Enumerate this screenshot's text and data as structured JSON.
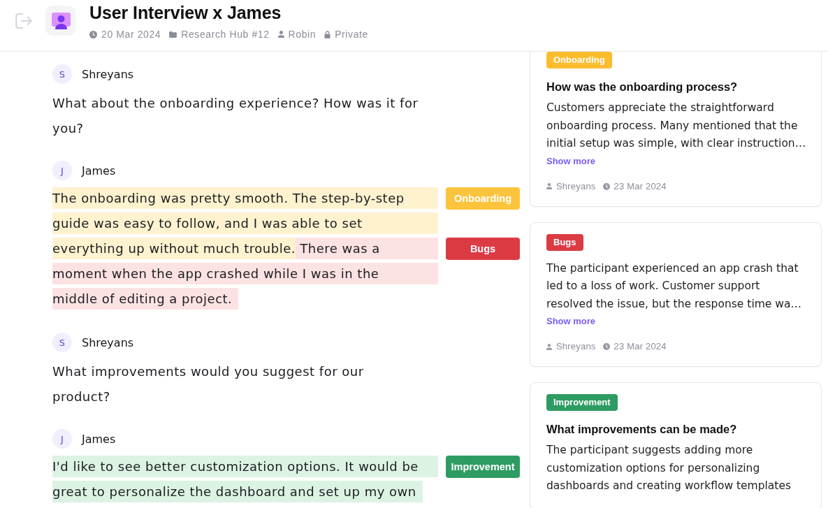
{
  "header": {
    "title": "User Interview x James",
    "meta": [
      {
        "kind": "date",
        "text": "20 Mar 2024"
      },
      {
        "kind": "folder",
        "text": "Research Hub #12"
      },
      {
        "kind": "owner",
        "text": "Robin"
      },
      {
        "kind": "visibility",
        "text": "Private"
      }
    ]
  },
  "transcript": [
    {
      "kind": "plain",
      "speaker": "Shreyans",
      "initial": "S",
      "text": "What about the onboarding experience? How was it for you?"
    },
    {
      "kind": "highlighted",
      "speaker": "James",
      "initial": "J",
      "lines": [
        [
          {
            "text": "The onboarding was pretty smooth. The step-by-step",
            "color": "#fef2cf"
          }
        ],
        [
          {
            "text": "guide was easy to follow, and I was able to set",
            "color": "#fef2cf"
          }
        ],
        [
          {
            "text": "everything up without much trouble.",
            "color": "#fef2cf"
          },
          {
            "text": " There was a",
            "color": "#fde2e3"
          }
        ],
        [
          {
            "text": "moment when the app crashed while I was in the",
            "color": "#fde2e3"
          }
        ],
        [
          {
            "text": "middle of editing a project.",
            "color": "#fde2e3"
          }
        ]
      ],
      "tags": [
        {
          "label": "Onboarding",
          "color": "#fcc43c"
        },
        {
          "label": "Bugs",
          "color": "#dc3b44"
        }
      ]
    },
    {
      "kind": "plain",
      "speaker": "Shreyans",
      "initial": "S",
      "text": "What improvements would you suggest for our product?"
    },
    {
      "kind": "highlighted",
      "speaker": "James",
      "initial": "J",
      "lines": [
        [
          {
            "text": "I'd like to see better customization options. It would be",
            "color": "#dcf3e3"
          }
        ],
        [
          {
            "text": "great to personalize the dashboard and set up my own",
            "color": "#dcf3e3"
          }
        ]
      ],
      "tags": [
        {
          "label": "Improvement",
          "color": "#2e9c62"
        }
      ]
    }
  ],
  "insights": [
    {
      "tag": {
        "label": "Onboarding",
        "color": "#fbbd2e"
      },
      "title": "How was the onboarding process?",
      "summary": "Customers appreciate the straightforward onboarding process. Many mentioned that the initial setup was simple, with clear instruction…",
      "link": "Show more",
      "author": "Shreyans",
      "date": "23 Mar 2024"
    },
    {
      "tag": {
        "label": "Bugs",
        "color": "#dc3b44"
      },
      "summary": "The participant experienced an app crash that led to a loss of work. Customer support resolved the issue, but the response time wa…",
      "link": "Show more",
      "author": "Shreyans",
      "date": "23 Mar 2024"
    },
    {
      "tag": {
        "label": "Improvement",
        "color": "#2e9c62"
      },
      "title": "What improvements can be made?",
      "summary": "The participant suggests adding more customization options for personalizing dashboards and creating workflow templates"
    }
  ]
}
